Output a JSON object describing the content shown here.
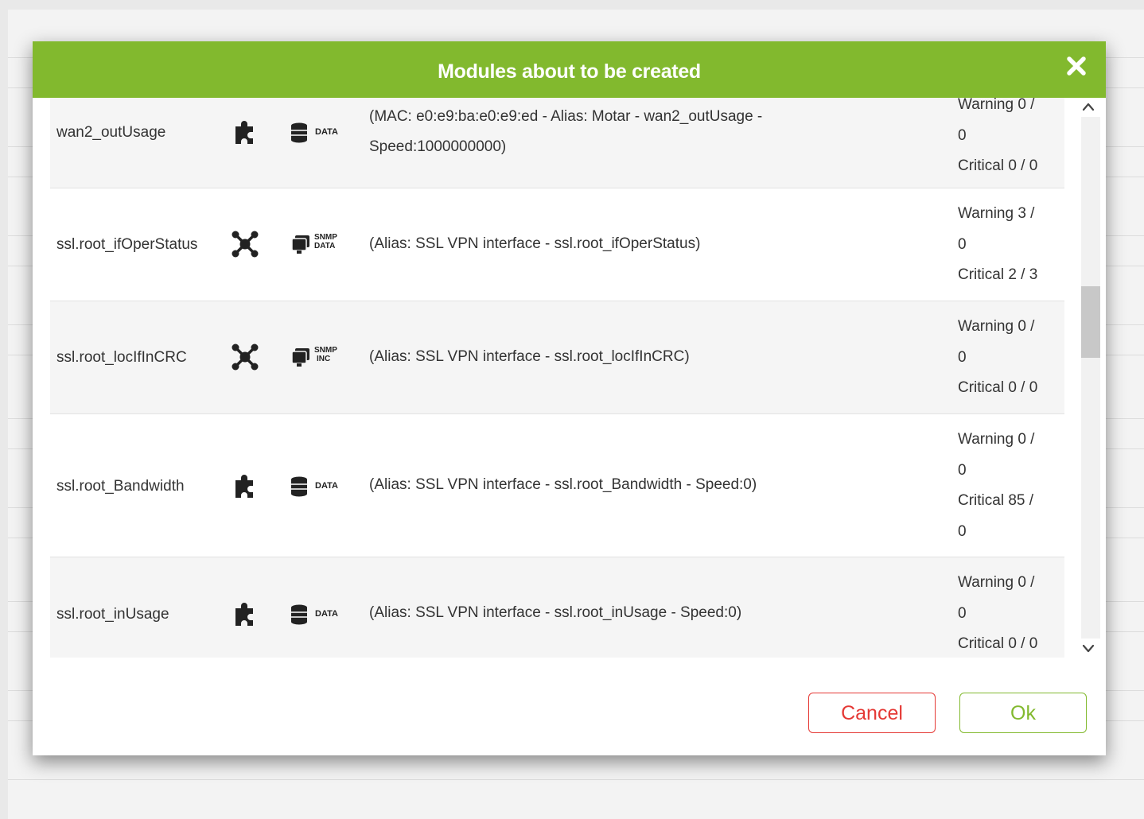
{
  "dialog": {
    "title": "Modules about to be created",
    "close_icon": "close-x-icon",
    "accent_color": "#82b92e",
    "cancel_label": "Cancel",
    "ok_label": "Ok",
    "cancel_color": "#e53935"
  },
  "modules": [
    {
      "name": "wan2_outUsage",
      "type_icon": "plugin-puzzle-icon",
      "kind_icon": "data-database-icon",
      "kind_label": "DATA",
      "description": "(MAC: e0:e9:ba:e0:e9:ed - Alias: Motar - wan2_outUsage - Speed:1000000000)",
      "threshold_lines": [
        "Warning 0 /",
        "0",
        "Critical 0 / 0"
      ]
    },
    {
      "name": "ssl.root_ifOperStatus",
      "type_icon": "network-node-icon",
      "kind_icon": "snmp-data-icon",
      "kind_label": [
        "SNMP",
        "DATA"
      ],
      "description": "(Alias: SSL VPN interface - ssl.root_ifOperStatus)",
      "threshold_lines": [
        "Warning 3 /",
        "0",
        "Critical 2 / 3"
      ]
    },
    {
      "name": "ssl.root_locIfInCRC",
      "type_icon": "network-node-icon",
      "kind_icon": "snmp-inc-icon",
      "kind_label": [
        "SNMP",
        "INC"
      ],
      "description": "(Alias: SSL VPN interface - ssl.root_locIfInCRC)",
      "threshold_lines": [
        "Warning 0 /",
        "0",
        "Critical 0 / 0"
      ]
    },
    {
      "name": "ssl.root_Bandwidth",
      "type_icon": "plugin-puzzle-icon",
      "kind_icon": "data-database-icon",
      "kind_label": "DATA",
      "description": "(Alias: SSL VPN interface - ssl.root_Bandwidth - Speed:0)",
      "threshold_lines": [
        "Warning 0 /",
        "0",
        "Critical 85 /",
        "0"
      ]
    },
    {
      "name": "ssl.root_inUsage",
      "type_icon": "plugin-puzzle-icon",
      "kind_icon": "data-database-icon",
      "kind_label": "DATA",
      "description": "(Alias: SSL VPN interface - ssl.root_inUsage - Speed:0)",
      "threshold_lines": [
        "Warning 0 /",
        "0",
        "Critical 0 / 0"
      ]
    }
  ]
}
